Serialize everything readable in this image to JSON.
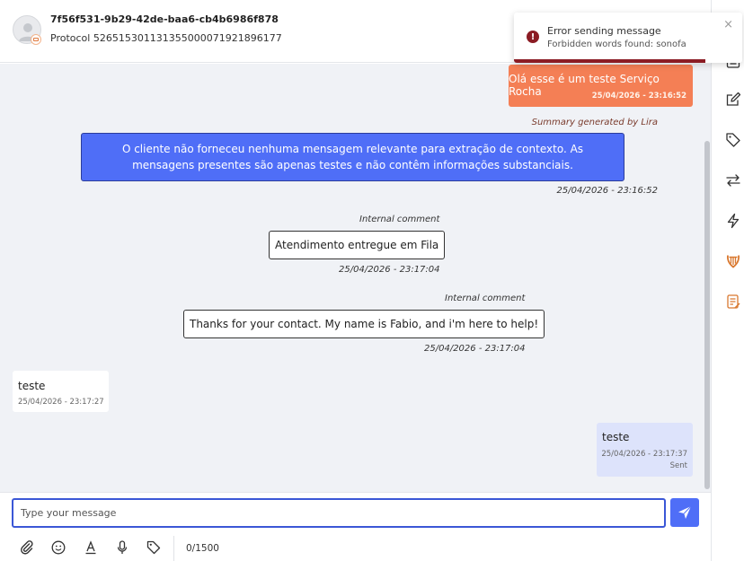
{
  "header": {
    "contact_id": "7f56f531-9b29-42de-baa6-cb4b6986f878",
    "protocol": "Protocol 526515301131355000071921896177"
  },
  "toast": {
    "title": "Error sending message",
    "message": "Forbidden words found: sonofa",
    "close": "×",
    "icon": "!",
    "progress": 0.84
  },
  "messages": {
    "outgoing_1": {
      "text": "Olá esse é um teste Serviço Rocha",
      "time": "25/04/2026 - 23:16:52"
    },
    "summary": {
      "label": "Summary generated by Lira",
      "text": "O cliente não forneceu nenhuma mensagem relevante para extração de contexto. As mensagens presentes são apenas testes e não contêm informações substanciais.",
      "time": "25/04/2026 - 23:16:52"
    },
    "comment_1": {
      "label": "Internal comment",
      "text": "Atendimento entregue em Fila",
      "time": "25/04/2026 - 23:17:04"
    },
    "comment_2": {
      "label": "Internal comment",
      "text": "Thanks for your contact. My name is Fabio, and i'm here to help!",
      "time": "25/04/2026 - 23:17:04"
    },
    "incoming_1": {
      "text": "teste",
      "time": "25/04/2026 - 23:17:27"
    },
    "outgoing_2": {
      "text": "teste",
      "time": "25/04/2026 - 23:17:37",
      "status": "Sent"
    }
  },
  "composer": {
    "placeholder": "Type your message",
    "counter": "0/1500",
    "tools": [
      "paperclip-icon",
      "emoji-icon",
      "text-format-icon",
      "microphone-icon",
      "tag-icon"
    ]
  },
  "right_bar": {
    "icons": [
      "notes-icon",
      "edit-icon",
      "tag-icon",
      "transfer-icon",
      "lightning-icon",
      "lira-icon",
      "script-icon"
    ]
  },
  "colors": {
    "accent": "#4f6ef7",
    "outgoing_bubble": "#f47f55",
    "outgoing_sent_bubble": "#dde3fb",
    "chat_bg": "#f0f2f6",
    "error": "#8b1c24"
  }
}
